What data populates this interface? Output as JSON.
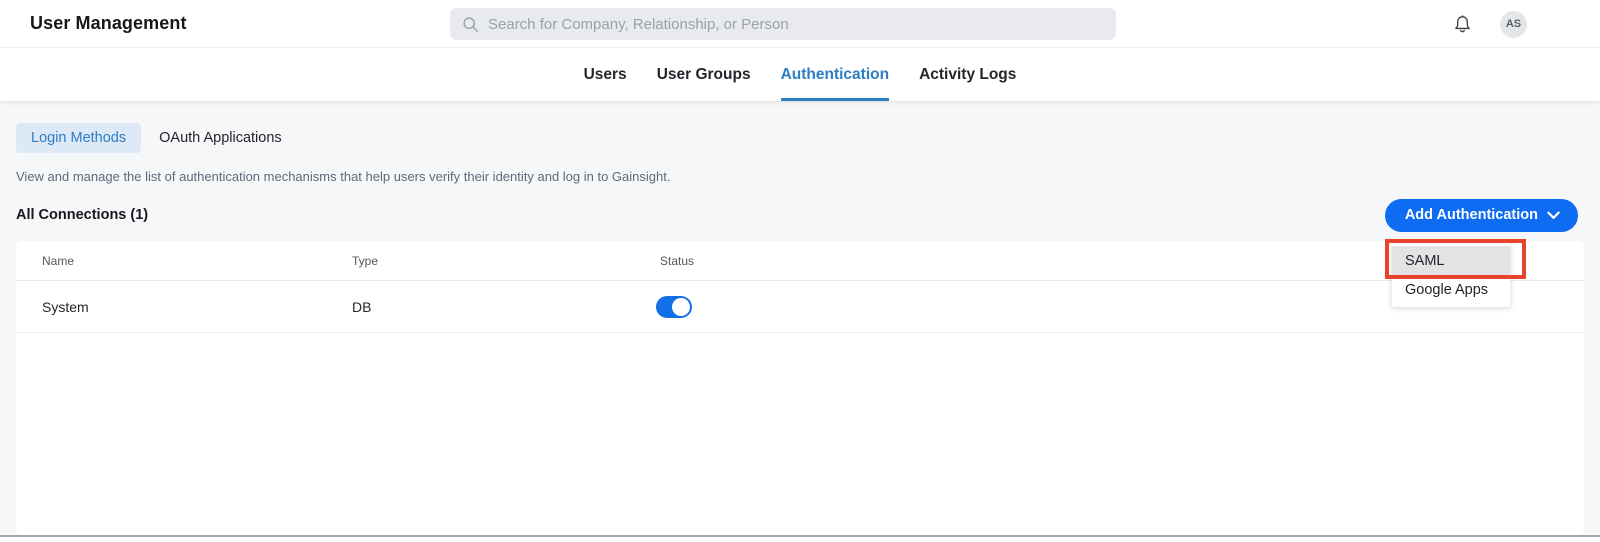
{
  "header": {
    "title": "User Management",
    "search_placeholder": "Search for Company, Relationship, or Person",
    "avatar_initials": "AS"
  },
  "tabs": {
    "items": [
      {
        "label": "Users",
        "active": false
      },
      {
        "label": "User Groups",
        "active": false
      },
      {
        "label": "Authentication",
        "active": true
      },
      {
        "label": "Activity Logs",
        "active": false
      }
    ]
  },
  "subtabs": {
    "items": [
      {
        "label": "Login Methods",
        "active": true
      },
      {
        "label": "OAuth Applications",
        "active": false
      }
    ]
  },
  "description": "View and manage the list of authentication mechanisms that help users verify their identity and log in to Gainsight.",
  "section": {
    "title": "All Connections (1)",
    "add_button_label": "Add Authentication"
  },
  "dropdown": {
    "items": [
      {
        "label": "SAML",
        "highlighted": true,
        "annotated": true
      },
      {
        "label": "Google Apps",
        "highlighted": false,
        "annotated": false
      }
    ]
  },
  "table": {
    "columns": [
      "Name",
      "Type",
      "Status"
    ],
    "rows": [
      {
        "name": "System",
        "type": "DB",
        "status": "on"
      }
    ]
  },
  "colors": {
    "accent_blue": "#0d6cf2",
    "tab_active_blue": "#2d7dc3",
    "toggle_blue": "#1170e8",
    "annotation_red": "#e8432d",
    "subtab_pill_bg": "#dde9f6",
    "content_bg": "#f6f7f8"
  }
}
